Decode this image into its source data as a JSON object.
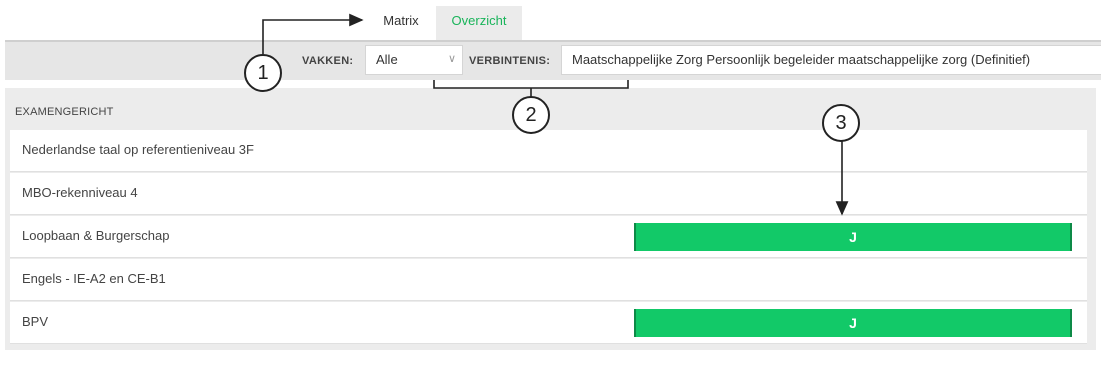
{
  "tabs": [
    {
      "label": "Matrix",
      "active": false
    },
    {
      "label": "Overzicht",
      "active": true
    }
  ],
  "toolbar": {
    "vakken_label": "VAKKEN:",
    "vakken_value": "Alle",
    "verbintenis_label": "VERBINTENIS:",
    "verbintenis_value": "Maatschappelijke Zorg Persoonlijk begeleider maatschappelijke zorg (Definitief)"
  },
  "section": {
    "title": "EXAMENGERICHT"
  },
  "rows": [
    {
      "label": "Nederlandse taal op referentieniveau 3F",
      "result": ""
    },
    {
      "label": "MBO-rekenniveau 4",
      "result": ""
    },
    {
      "label": "Loopbaan & Burgerschap",
      "result": "J"
    },
    {
      "label": "Engels - IE-A2 en CE-B1",
      "result": ""
    },
    {
      "label": "BPV",
      "result": "J"
    }
  ],
  "callouts": [
    "1",
    "2",
    "3"
  ],
  "colors": {
    "accent_green": "#12c968",
    "tab_active_text": "#19b45a",
    "toolbar_bg": "#e6e6e6"
  },
  "icons": {
    "dropdown": "chevron-down-icon"
  }
}
